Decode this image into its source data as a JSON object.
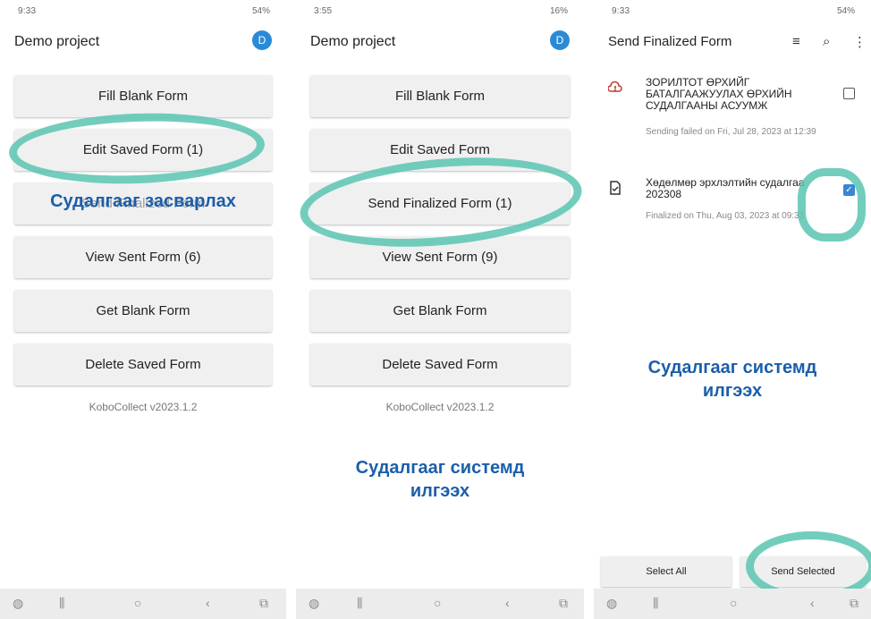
{
  "screen1": {
    "status_time": "9:33",
    "status_right": "54%",
    "title": "Demo project",
    "avatar_letter": "D",
    "buttons": [
      "Fill Blank Form",
      "Edit Saved Form (1)",
      "Send Finalized Form",
      "View Sent Form (6)",
      "Get Blank Form",
      "Delete Saved Form"
    ],
    "version": "KoboCollect v2023.1.2",
    "annotation": "Судалгааг засварлах"
  },
  "screen2": {
    "status_time": "3:55",
    "status_right": "16%",
    "title": "Demo project",
    "avatar_letter": "D",
    "buttons": [
      "Fill Blank Form",
      "Edit Saved Form",
      "Send Finalized Form (1)",
      "View Sent Form (9)",
      "Get Blank Form",
      "Delete Saved Form"
    ],
    "version": "KoboCollect v2023.1.2",
    "annotation_line1": "Судалгааг системд",
    "annotation_line2": "илгээх"
  },
  "screen3": {
    "status_time": "9:33",
    "status_right": "54%",
    "title": "Send Finalized Form",
    "items": [
      {
        "title": "ЗОРИЛТОТ ӨРХИЙГ БАТАЛГААЖУУЛАХ ӨРХИЙН СУДАЛГААНЫ АСУУМЖ",
        "subtitle": "Sending failed on Fri, Jul 28, 2023 at 12:39",
        "icon": "cloud-error-icon",
        "checked": false
      },
      {
        "title": "Хөдөлмөр эрхлэлтийн судалгаа 202308",
        "subtitle": "Finalized on Thu, Aug 03, 2023 at 09:33",
        "icon": "document-check-icon",
        "checked": true
      }
    ],
    "annotation_line1": "Судалгааг системд",
    "annotation_line2": "илгээх",
    "select_all": "Select All",
    "send_selected": "Send Selected"
  },
  "colors": {
    "highlight": "#5bc4b1",
    "annotation": "#1b5eaa",
    "avatar": "#2b8ad6"
  }
}
